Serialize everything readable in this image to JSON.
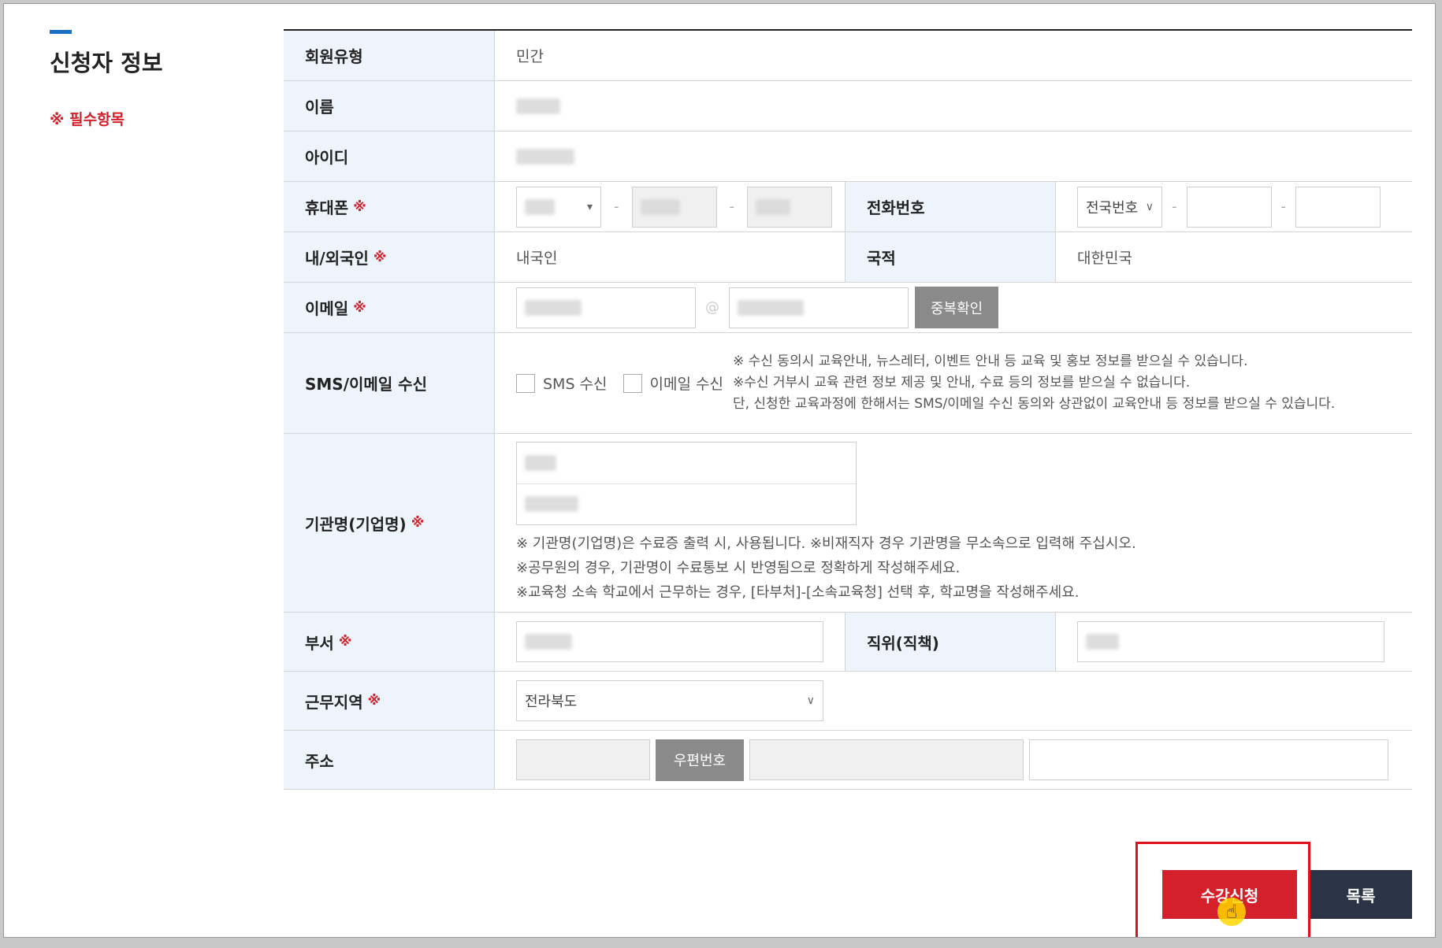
{
  "section": {
    "title": "신청자 정보",
    "required_note": "※ 필수항목"
  },
  "required_mark": "※",
  "fields": {
    "member_type": {
      "label": "회원유형",
      "value": "민간"
    },
    "name": {
      "label": "이름"
    },
    "user_id": {
      "label": "아이디"
    },
    "mobile": {
      "label": "휴대폰"
    },
    "phone": {
      "label": "전화번호",
      "area_select": "전국번호",
      "separator": "-"
    },
    "nationality_type": {
      "label": "내/외국인",
      "value": "내국인"
    },
    "nationality": {
      "label": "국적",
      "value": "대한민국"
    },
    "email": {
      "label": "이메일",
      "at": "@",
      "check_button": "중복확인"
    },
    "sms_email": {
      "label": "SMS/이메일 수신",
      "sms_label": "SMS 수신",
      "email_label": "이메일 수신",
      "notes": [
        "※ 수신 동의시 교육안내, 뉴스레터, 이벤트 안내 등 교육 및 홍보 정보를 받으실 수 있습니다.",
        "※수신 거부시 교육 관련 정보 제공 및 안내, 수료 등의 정보를 받으실 수 없습니다.",
        "단, 신청한 교육과정에 한해서는 SMS/이메일 수신 동의와 상관없이 교육안내 등 정보를 받으실 수 있습니다."
      ]
    },
    "organization": {
      "label": "기관명(기업명)",
      "notes": [
        "※ 기관명(기업명)은 수료증 출력 시, 사용됩니다. ※비재직자 경우 기관명을 무소속으로 입력해 주십시오.",
        "※공무원의 경우, 기관명이 수료통보 시 반영됨으로 정확하게 작성해주세요.",
        "※교육청 소속 학교에서 근무하는 경우, [타부처]-[소속교육청] 선택 후, 학교명을 작성해주세요."
      ]
    },
    "department": {
      "label": "부서"
    },
    "position": {
      "label": "직위(직책)"
    },
    "work_region": {
      "label": "근무지역",
      "value": "전라북도"
    },
    "address": {
      "label": "주소",
      "zip_button": "우편번호"
    }
  },
  "actions": {
    "apply": "수강신청",
    "list": "목록"
  }
}
